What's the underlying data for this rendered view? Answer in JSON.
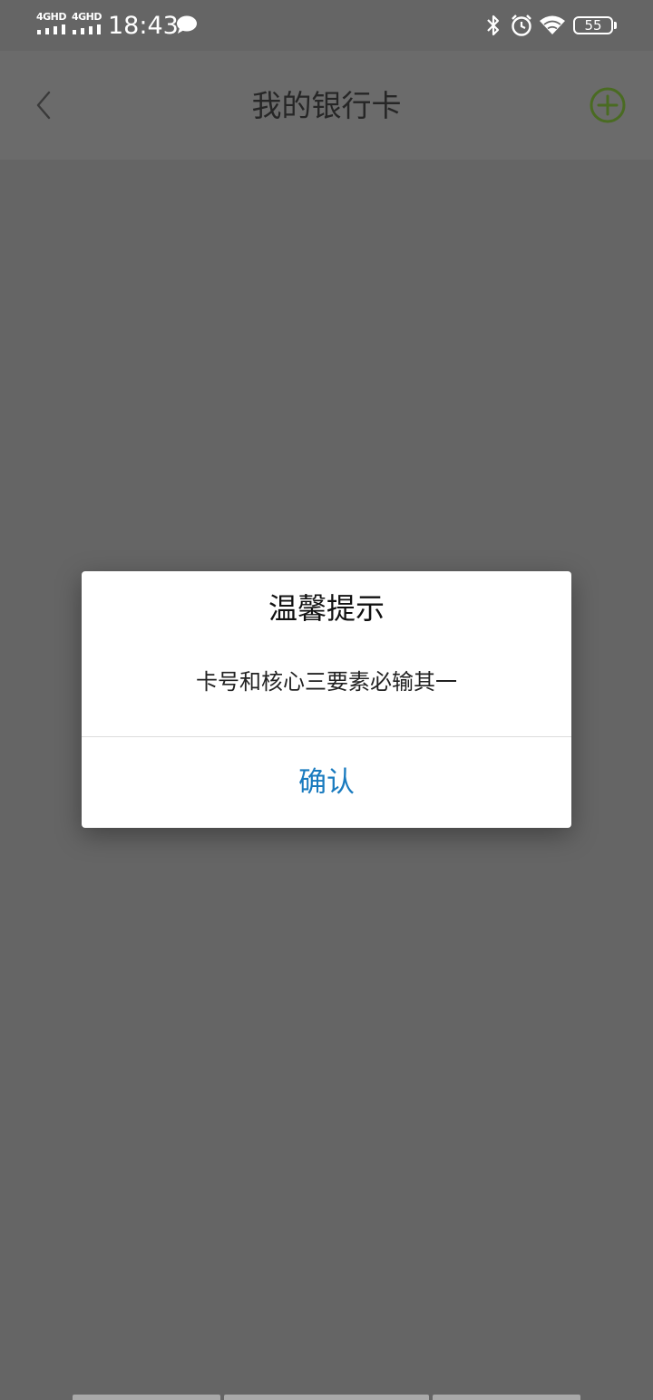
{
  "status_bar": {
    "network1": "4GHD",
    "network2": "4GHD",
    "time": "18:43",
    "battery": "55",
    "icons": [
      "signal-icon",
      "chat-icon",
      "bluetooth-icon",
      "alarm-icon",
      "wifi-icon",
      "battery-icon"
    ]
  },
  "nav": {
    "title": "我的银行卡",
    "back_icon": "back-arrow-icon",
    "add_icon": "add-circle-icon",
    "add_color": "#4a6b22"
  },
  "dialog": {
    "title": "温馨提示",
    "message": "卡号和核心三要素必输其一",
    "confirm_label": "确认",
    "confirm_color": "#1a7bbf"
  }
}
